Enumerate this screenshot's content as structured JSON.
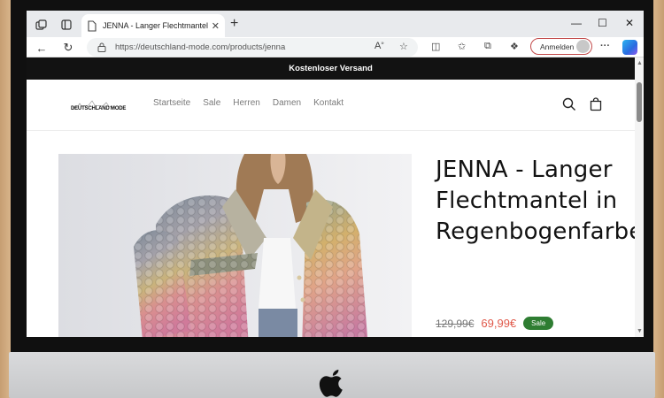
{
  "browser": {
    "tab_title": "JENNA - Langer Flechtmantel in Regenbogenfarben",
    "url": "https://deutschland-mode.com/products/jenna",
    "signin_label": "Anmelden"
  },
  "store": {
    "announcement": "Kostenloser Versand",
    "logo_text": "DEUTSCHLAND MODE",
    "nav": [
      "Startseite",
      "Sale",
      "Herren",
      "Damen",
      "Kontakt"
    ]
  },
  "product": {
    "title": "JENNA - Langer Flechtmantel in Regenbogenfarben",
    "old_price": "129,99€",
    "new_price": "69,99€",
    "badge": "Sale"
  },
  "colors": {
    "announcement_bg": "#121212",
    "sale_badge": "#2e7d32",
    "sale_price": "#e0594a",
    "signin_border": "#c24a4a"
  },
  "icons": [
    "workspaces-icon",
    "tab-actions-icon",
    "page-icon",
    "close-icon",
    "new-tab-icon",
    "minimize-icon",
    "maximize-icon",
    "window-close-icon",
    "back-icon",
    "refresh-icon",
    "lock-icon",
    "read-aloud-icon",
    "favorite-icon",
    "split-screen-icon",
    "favorites-icon",
    "collections-icon",
    "extensions-icon",
    "profile-avatar-icon",
    "more-icon",
    "copilot-icon",
    "search-icon",
    "cart-icon",
    "apple-logo-icon"
  ]
}
